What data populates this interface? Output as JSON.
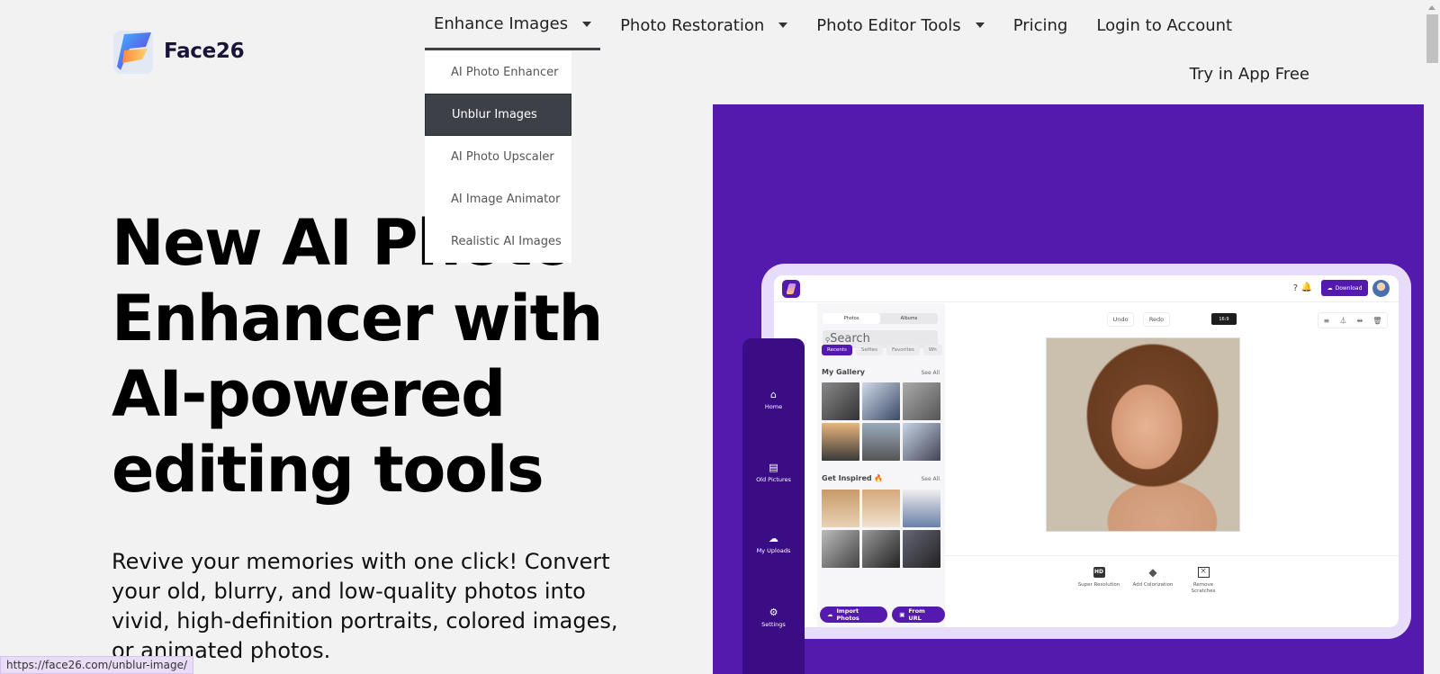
{
  "brand": {
    "name": "Face26",
    "accent": "#5419ad"
  },
  "nav": {
    "items": [
      {
        "label": "Enhance Images",
        "has_dropdown": true,
        "active": true
      },
      {
        "label": "Photo Restoration",
        "has_dropdown": true
      },
      {
        "label": "Photo Editor Tools",
        "has_dropdown": true
      },
      {
        "label": "Pricing"
      },
      {
        "label": "Login to Account"
      }
    ],
    "cta": "Try in App Free"
  },
  "dropdown": {
    "items": [
      {
        "label": "AI Photo Enhancer"
      },
      {
        "label": "Unblur Images",
        "selected": true
      },
      {
        "label": "AI Photo Upscaler"
      },
      {
        "label": "AI Image Animator"
      },
      {
        "label": "Realistic AI Images"
      }
    ]
  },
  "hero": {
    "title": "New AI Photo Enhancer with AI-powered editing tools",
    "description": "Revive your memories with one click! Convert your old, blurry, and low-quality photos into vivid, high-definition portraits, colored images, or animated photos."
  },
  "status_bar": {
    "url": "https://face26.com/unblur-image/"
  },
  "app_mockup": {
    "download_label": "Download",
    "segments": [
      "Photos",
      "Albums"
    ],
    "search_placeholder": "Search",
    "chips": [
      "Recents",
      "Selfies",
      "Favorites",
      "Wh"
    ],
    "my_gallery": "My Gallery",
    "get_inspired": "Get Inspired 🔥",
    "see_all": "See All",
    "import_photos": "Import Photos",
    "from_url": "From URL",
    "undo": "Undo",
    "redo": "Redo",
    "ratio": "16:9",
    "sidebar": [
      "Home",
      "Old Pictures",
      "My Uploads",
      "Settings"
    ],
    "tools": [
      "Super Resolution",
      "Add Colorization",
      "Remove Scratches"
    ]
  }
}
